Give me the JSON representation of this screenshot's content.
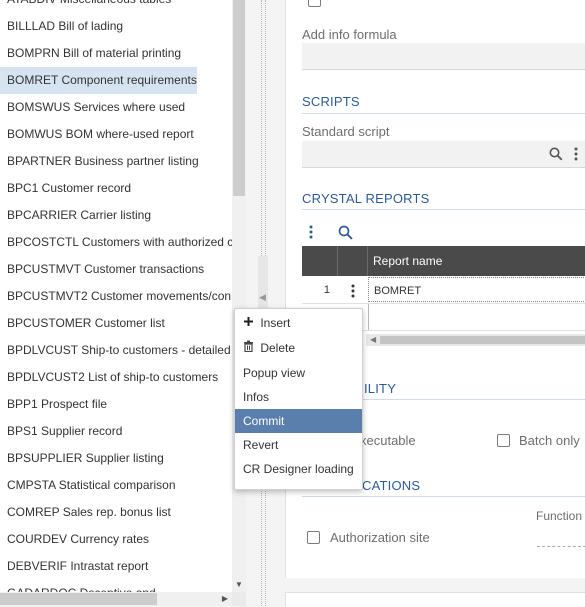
{
  "left_list": {
    "items": [
      {
        "label": "ATABDIV Miscellaneous tables",
        "selected": false
      },
      {
        "label": "BILLLAD Bill of lading",
        "selected": false
      },
      {
        "label": "BOMPRN Bill of material printing",
        "selected": false
      },
      {
        "label": "BOMRET Component requirements",
        "selected": true
      },
      {
        "label": "BOMSWUS Services where used",
        "selected": false
      },
      {
        "label": "BOMWUS BOM where-used report",
        "selected": false
      },
      {
        "label": "BPARTNER Business partner listing",
        "selected": false
      },
      {
        "label": "BPC1 Customer record",
        "selected": false
      },
      {
        "label": "BPCARRIER Carrier listing",
        "selected": false
      },
      {
        "label": "BPCOSTCTL Customers with authorized c",
        "selected": false
      },
      {
        "label": "BPCUSTMVT Customer transactions",
        "selected": false
      },
      {
        "label": "BPCUSTMVT2 Customer movements/con",
        "selected": false
      },
      {
        "label": "BPCUSTOMER Customer list",
        "selected": false
      },
      {
        "label": "BPDLVCUST Ship-to customers - detailed",
        "selected": false
      },
      {
        "label": "BPDLVCUST2 List of ship-to customers",
        "selected": false
      },
      {
        "label": "BPP1 Prospect file",
        "selected": false
      },
      {
        "label": "BPS1 Supplier record",
        "selected": false
      },
      {
        "label": "BPSUPPLIER Supplier listing",
        "selected": false
      },
      {
        "label": "CMPSTA Statistical comparison",
        "selected": false
      },
      {
        "label": "COMREP Sales rep. bonus list",
        "selected": false
      },
      {
        "label": "COURDEV Currency rates",
        "selected": false
      },
      {
        "label": "DEBVERIF Intrastat report",
        "selected": false
      },
      {
        "label": "GADARDOC Dsceptive and",
        "selected": false
      }
    ]
  },
  "right_panel": {
    "add_info_formula_label": "Add info formula",
    "scripts_title": "SCRIPTS",
    "standard_script_label": "Standard script",
    "crystal_reports_title": "CRYSTAL REPORTS",
    "grid": {
      "column_header": "Report name",
      "rows": [
        {
          "num": "1",
          "report_name": "BOMRET"
        }
      ]
    },
    "usability_title_partial": "ILITY",
    "executable_label_partial": "xecutable",
    "batch_only_label": "Batch only",
    "authorizations_title_partial": "CATIONS",
    "authorization_site_label": "Authorization site",
    "function_label_partial": "Function"
  },
  "context_menu": {
    "items": [
      {
        "label": "Insert",
        "icon": "plus-icon",
        "highlight": false
      },
      {
        "label": "Delete",
        "icon": "trash-icon",
        "highlight": false
      },
      {
        "label": "Popup view",
        "icon": "",
        "highlight": false
      },
      {
        "label": "Infos",
        "icon": "",
        "highlight": false
      },
      {
        "label": "Commit",
        "icon": "",
        "highlight": true
      },
      {
        "label": "Revert",
        "icon": "",
        "highlight": false
      },
      {
        "label": "CR Designer loading",
        "icon": "",
        "highlight": false
      }
    ]
  },
  "colors": {
    "accent": "#2a5aa0",
    "selected_row": "#d6e4f2",
    "menu_highlight": "#5b7fad",
    "grid_header": "#4a4a4a"
  }
}
